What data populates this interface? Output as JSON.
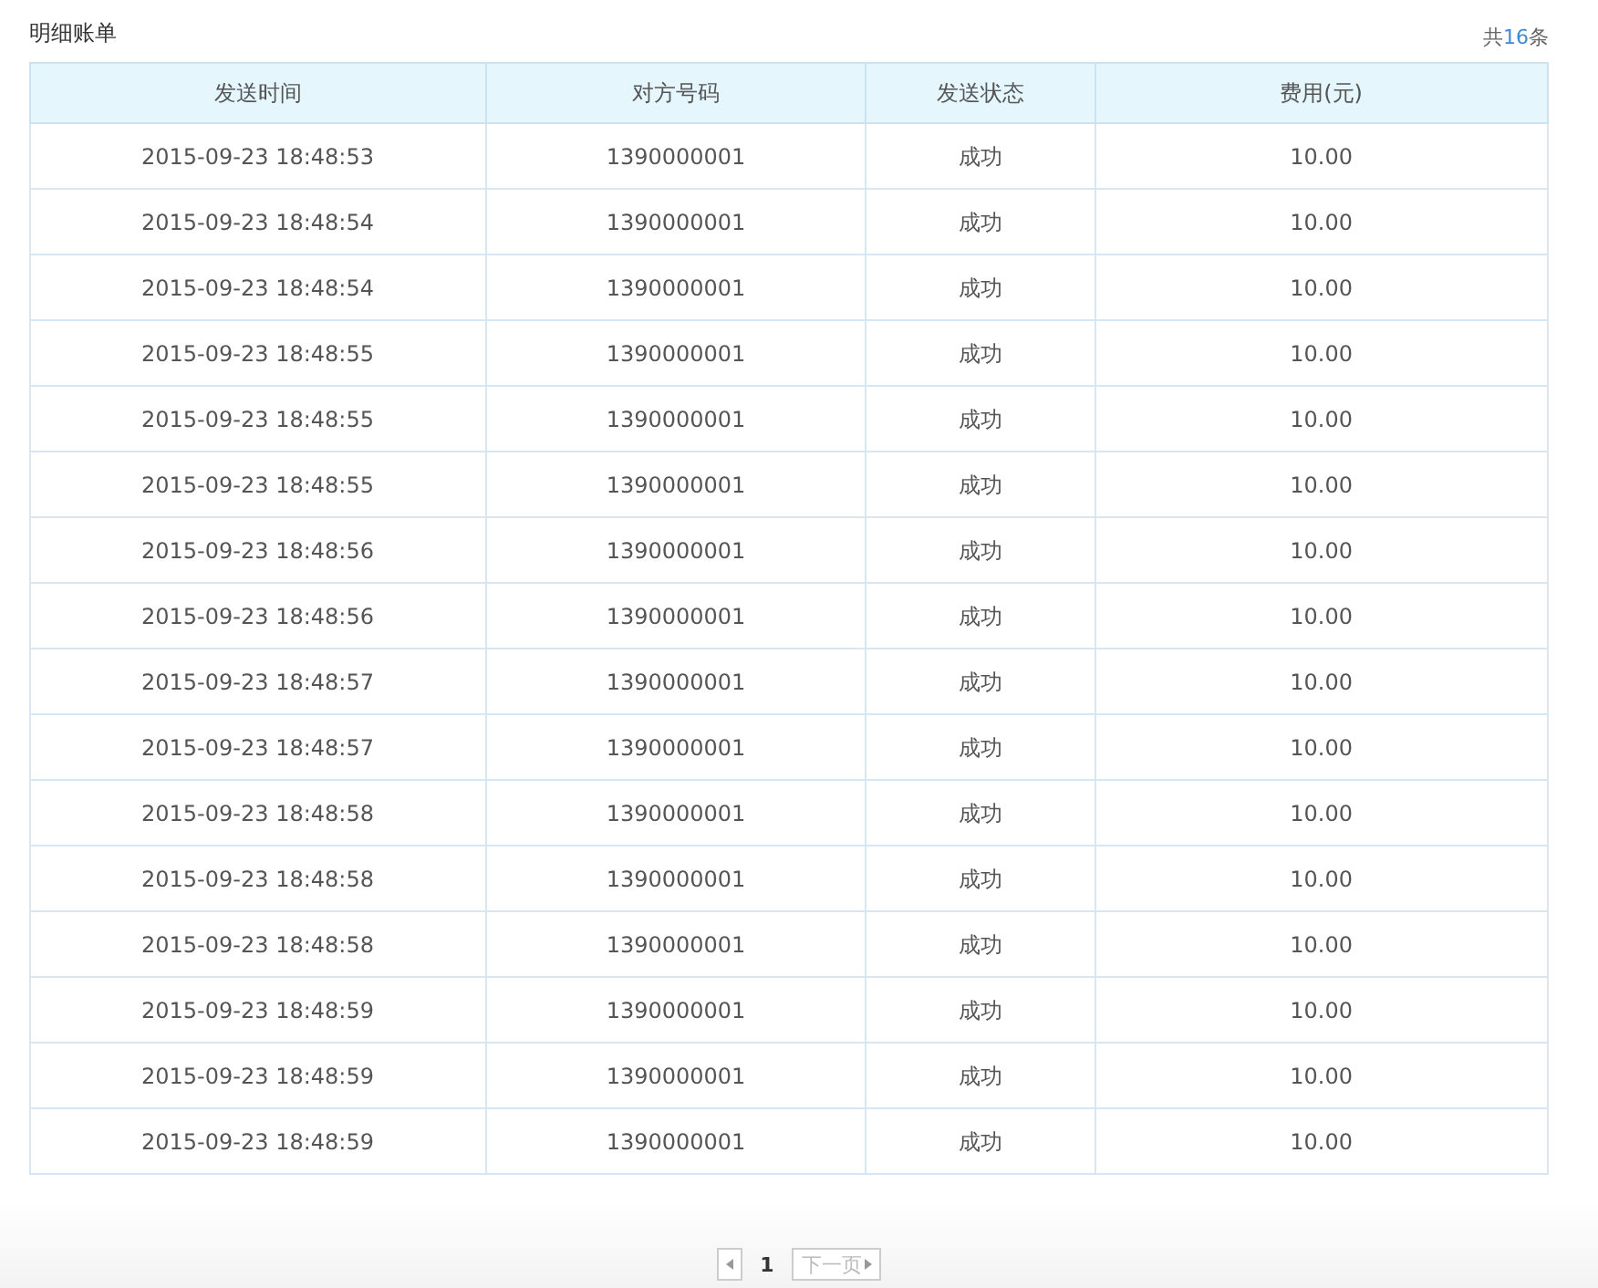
{
  "title": "明细账单",
  "total": {
    "prefix": "共",
    "count": "16",
    "suffix": "条"
  },
  "table": {
    "columns": [
      "发送时间",
      "对方号码",
      "发送状态",
      "费用(元)"
    ],
    "rows": [
      [
        "2015-09-23 18:48:53",
        "1390000001",
        "成功",
        "10.00"
      ],
      [
        "2015-09-23 18:48:54",
        "1390000001",
        "成功",
        "10.00"
      ],
      [
        "2015-09-23 18:48:54",
        "1390000001",
        "成功",
        "10.00"
      ],
      [
        "2015-09-23 18:48:55",
        "1390000001",
        "成功",
        "10.00"
      ],
      [
        "2015-09-23 18:48:55",
        "1390000001",
        "成功",
        "10.00"
      ],
      [
        "2015-09-23 18:48:55",
        "1390000001",
        "成功",
        "10.00"
      ],
      [
        "2015-09-23 18:48:56",
        "1390000001",
        "成功",
        "10.00"
      ],
      [
        "2015-09-23 18:48:56",
        "1390000001",
        "成功",
        "10.00"
      ],
      [
        "2015-09-23 18:48:57",
        "1390000001",
        "成功",
        "10.00"
      ],
      [
        "2015-09-23 18:48:57",
        "1390000001",
        "成功",
        "10.00"
      ],
      [
        "2015-09-23 18:48:58",
        "1390000001",
        "成功",
        "10.00"
      ],
      [
        "2015-09-23 18:48:58",
        "1390000001",
        "成功",
        "10.00"
      ],
      [
        "2015-09-23 18:48:58",
        "1390000001",
        "成功",
        "10.00"
      ],
      [
        "2015-09-23 18:48:59",
        "1390000001",
        "成功",
        "10.00"
      ],
      [
        "2015-09-23 18:48:59",
        "1390000001",
        "成功",
        "10.00"
      ],
      [
        "2015-09-23 18:48:59",
        "1390000001",
        "成功",
        "10.00"
      ]
    ]
  },
  "pagination": {
    "prev": {
      "disabled": true
    },
    "pages": [
      {
        "label": "1",
        "selected": true
      }
    ],
    "next": {
      "label": "下一页",
      "disabled": true
    }
  }
}
